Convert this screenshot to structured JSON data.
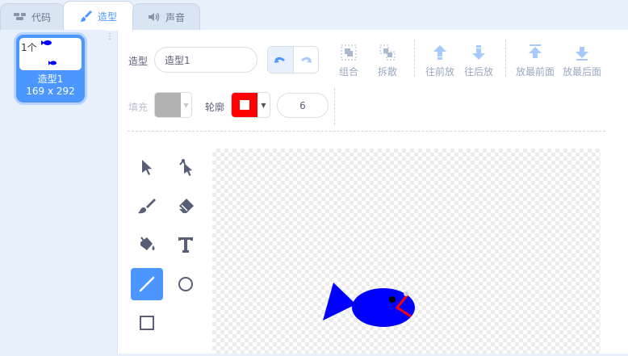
{
  "tabs": [
    {
      "label": "代码",
      "icon": "code-icon"
    },
    {
      "label": "造型",
      "icon": "brush-icon"
    },
    {
      "label": "声音",
      "icon": "speaker-icon"
    }
  ],
  "costumes": [
    {
      "number": "1个",
      "name": "造型1",
      "size": "169 x 292"
    }
  ],
  "editor": {
    "costume_label": "造型",
    "costume_name": "造型1",
    "fill_label": "填充",
    "outline_label": "轮廓",
    "outline_width": "6",
    "fill_color": "#b2b2b2",
    "outline_color": "#ff0000",
    "actions": {
      "group": "组合",
      "ungroup": "拆散",
      "forward": "往前放",
      "backward": "往后放",
      "front": "放最前面",
      "back": "放最后面"
    }
  },
  "tools": [
    "select-tool",
    "reshape-tool",
    "brush-tool",
    "eraser-tool",
    "fill-tool",
    "text-tool",
    "line-tool",
    "circle-tool",
    "rectangle-tool"
  ],
  "selected_tool": "line-tool",
  "colors": {
    "accent": "#4c97ff",
    "fish": "#0000ff",
    "fish_outline": "#ff0000"
  }
}
